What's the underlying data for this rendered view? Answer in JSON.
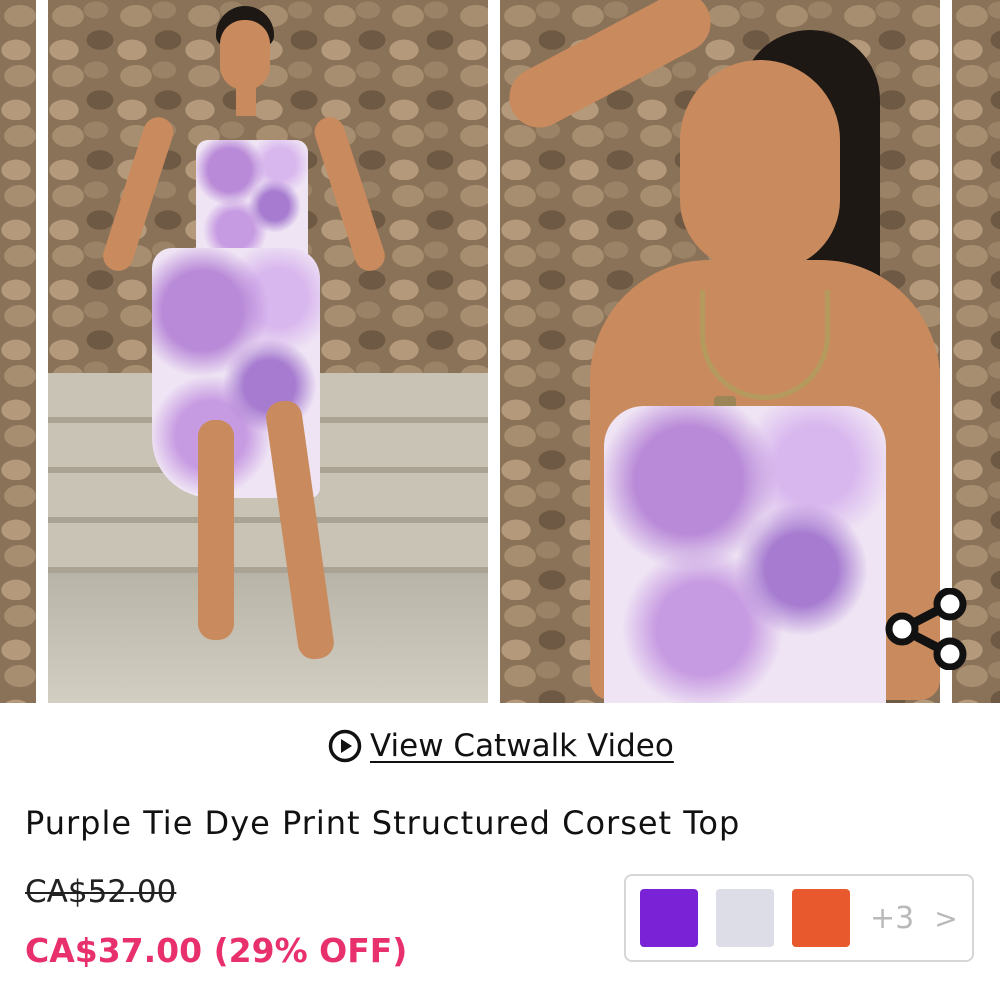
{
  "gallery": {
    "images": [
      {
        "description_icon": "image-icon"
      },
      {
        "description_icon": "image-icon"
      },
      {
        "description_icon": "image-icon"
      },
      {
        "description_icon": "image-icon"
      }
    ],
    "share_icon": "share-icon"
  },
  "catwalk": {
    "label": "View Catwalk Video",
    "icon": "play-circle-icon"
  },
  "product": {
    "title": "Purple Tie Dye Print Structured Corset Top",
    "original_price": "CA$52.00",
    "sale_price": "CA$37.00 (29% OFF)"
  },
  "colors": {
    "swatches": [
      "#7a22d6",
      "#dcdde6",
      "#e85a2e"
    ],
    "more_label": "+3",
    "chevron": ">"
  },
  "theme": {
    "sale_color": "#e8306d"
  }
}
